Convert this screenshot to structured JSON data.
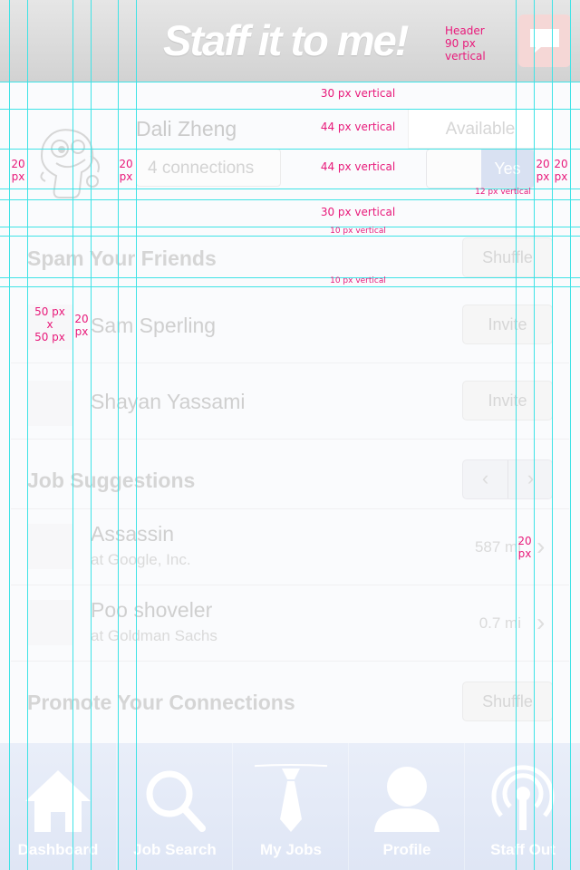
{
  "header": {
    "logo_text": "Staff it to me!",
    "chat_icon": "speech-bubble-icon"
  },
  "profile": {
    "avatar_icon": "mascot-avatar-icon",
    "name": "Dali Zheng",
    "connections": "4 connections",
    "availability_label": "Available",
    "availability_value": "Yes"
  },
  "spam": {
    "title": "Spam Your Friends",
    "shuffle_label": "Shuffle",
    "friends": [
      {
        "name": "Sam Sperling",
        "button": "Invite"
      },
      {
        "name": "Shayan Yassami",
        "button": "Invite"
      }
    ]
  },
  "jobs": {
    "title": "Job Suggestions",
    "prev": "‹",
    "next": "›",
    "items": [
      {
        "title": "Assassin",
        "company": "at Google, Inc.",
        "distance": "587 mi"
      },
      {
        "title": "Poo shoveler",
        "company": "at Goldman Sachs",
        "distance": "0.7 mi"
      }
    ]
  },
  "promote": {
    "title": "Promote Your Connections",
    "shuffle_label": "Shuffle"
  },
  "tabbar": {
    "tabs": [
      {
        "label": "Dashboard",
        "icon": "house-icon"
      },
      {
        "label": "Job Search",
        "icon": "magnifier-icon"
      },
      {
        "label": "My Jobs",
        "icon": "necktie-icon"
      },
      {
        "label": "Profile",
        "icon": "person-icon"
      },
      {
        "label": "Staff Out",
        "icon": "broadcast-icon"
      }
    ]
  },
  "annotations": {
    "header_height": "Header\n90 px\nvertical",
    "gap_30_top": "30 px vertical",
    "row_44_a": "44 px vertical",
    "row_44_b": "44 px vertical",
    "gap_12": "12 px vertical",
    "gap_30_bottom": "30 px vertical",
    "gap_10_a": "10 px vertical",
    "gap_10_b": "10 px vertical",
    "margin_left": "20\npx",
    "margin_mid": "20\npx",
    "margin_right_a": "20\npx",
    "margin_right_b": "20\npx",
    "thumb_size": "50 px\nx\n50 px",
    "thumb_gap": "20\npx",
    "chevron_gap": "20\npx"
  },
  "colors": {
    "header_bg": "#d9d9d9",
    "guide_lines": "#3fe3e6",
    "annotation_text": "#e8197a",
    "tabbar_bg": "#e4eaf7"
  }
}
